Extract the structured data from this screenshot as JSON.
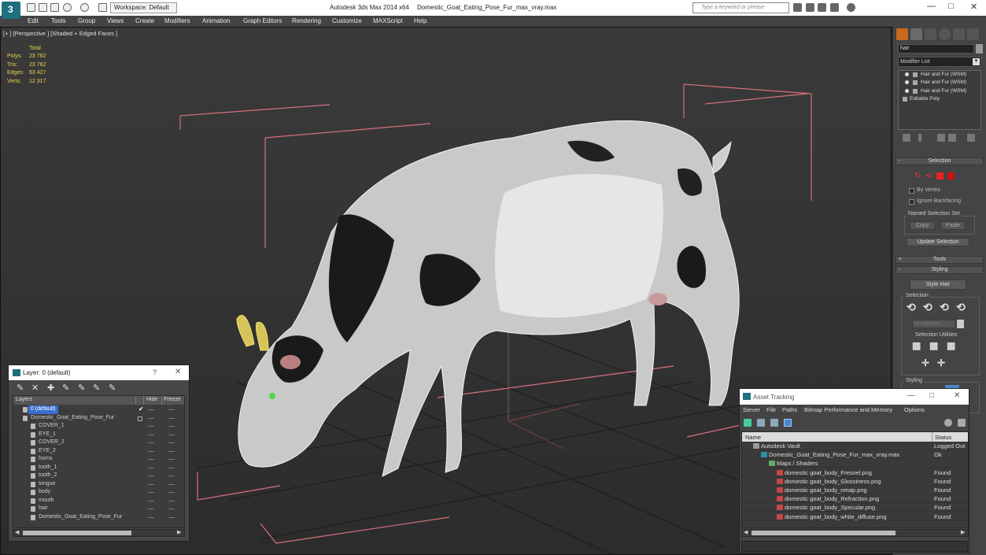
{
  "window": {
    "workspace_label": "Workspace: Default",
    "app_title": "Autodesk 3ds Max  2014 x64",
    "file_title": "Domestic_Goat_Eating_Pose_Fur_max_vray.max",
    "search_placeholder": "Type a keyword or phrase"
  },
  "menu": [
    "Edit",
    "Tools",
    "Group",
    "Views",
    "Create",
    "Modifiers",
    "Animation",
    "Graph Editors",
    "Rendering",
    "Customize",
    "MAXScript",
    "Help"
  ],
  "viewport": {
    "label": "[+ ] [Perspective ] [Shaded + Edged Faces ]",
    "stats": {
      "header": "Total",
      "rows": [
        {
          "key": "Polys:",
          "value": "23 762"
        },
        {
          "key": "Tris:",
          "value": "23 762"
        },
        {
          "key": "Edges:",
          "value": "63 427"
        },
        {
          "key": "Verts:",
          "value": "12 317"
        }
      ]
    }
  },
  "command_panel": {
    "object_name": "hair",
    "modifier_list": "Modifier List",
    "stack": [
      "Hair and Fur (WSM)",
      "Hair and Fur (WSM)",
      "Hair and Fur (WSM)",
      "Editable Poly"
    ],
    "selection_rollout": "Selection",
    "by_vertex": "By Vertex",
    "ignore_backfacing": "Ignore Backfacing",
    "named_selection_set": "Named Selection Set",
    "copy": "Copy",
    "paste": "Paste",
    "update_selection": "Update Selection",
    "tools_rollout": "Tools",
    "styling_rollout": "Styling",
    "style_hair": "Style Hair",
    "selection_group": "Selection",
    "no_marker": "No Marker",
    "selection_utilities": "Selection Utilities",
    "styling_group": "Styling"
  },
  "layer_panel": {
    "title": "Layer: 0 (default)",
    "help": "?",
    "columns": {
      "layers": "Layers",
      "hide": "Hide",
      "freeze": "Freeze"
    },
    "rows": [
      {
        "name": "0 (default)",
        "level": 0,
        "selected": true
      },
      {
        "name": "Domestic_Goat_Eating_Pose_Fur",
        "level": 0,
        "selected": false
      },
      {
        "name": "COVER_1",
        "level": 1,
        "selected": false
      },
      {
        "name": "EYE_1",
        "level": 1,
        "selected": false
      },
      {
        "name": "COVER_2",
        "level": 1,
        "selected": false
      },
      {
        "name": "EYE_2",
        "level": 1,
        "selected": false
      },
      {
        "name": "horns",
        "level": 1,
        "selected": false
      },
      {
        "name": "tooth_1",
        "level": 1,
        "selected": false
      },
      {
        "name": "tooth_2",
        "level": 1,
        "selected": false
      },
      {
        "name": "tongue",
        "level": 1,
        "selected": false
      },
      {
        "name": "body",
        "level": 1,
        "selected": false
      },
      {
        "name": "mouth",
        "level": 1,
        "selected": false
      },
      {
        "name": "hair",
        "level": 1,
        "selected": false
      },
      {
        "name": "Domestic_Goat_Eating_Pose_Fur",
        "level": 1,
        "selected": false
      }
    ]
  },
  "asset_tracking": {
    "title": "Asset Tracking",
    "menu": [
      "Server",
      "File",
      "Paths",
      "Bitmap Performance and Memory",
      "Options"
    ],
    "columns": {
      "name": "Name",
      "status": "Status"
    },
    "rows": [
      {
        "name": "Autodesk Vault",
        "status": "Logged Out",
        "level": 0,
        "kind": "vault"
      },
      {
        "name": "Domestic_Goat_Eating_Pose_Fur_max_vray.max",
        "status": "Ok",
        "level": 1,
        "kind": "max"
      },
      {
        "name": "Maps / Shaders",
        "status": "",
        "level": 2,
        "kind": "maps"
      },
      {
        "name": "domestic goat_body_Fresnel.png",
        "status": "Found",
        "level": 3,
        "kind": "png"
      },
      {
        "name": "domestic goat_body_Glossiness.png",
        "status": "Found",
        "level": 3,
        "kind": "png"
      },
      {
        "name": "domestic goat_body_nmap.png",
        "status": "Found",
        "level": 3,
        "kind": "png"
      },
      {
        "name": "domestic goat_body_Refraction.png",
        "status": "Found",
        "level": 3,
        "kind": "png"
      },
      {
        "name": "domestic goat_body_Specular.png",
        "status": "Found",
        "level": 3,
        "kind": "png"
      },
      {
        "name": "domestic goat_body_white_diffuse.png",
        "status": "Found",
        "level": 3,
        "kind": "png"
      }
    ]
  }
}
